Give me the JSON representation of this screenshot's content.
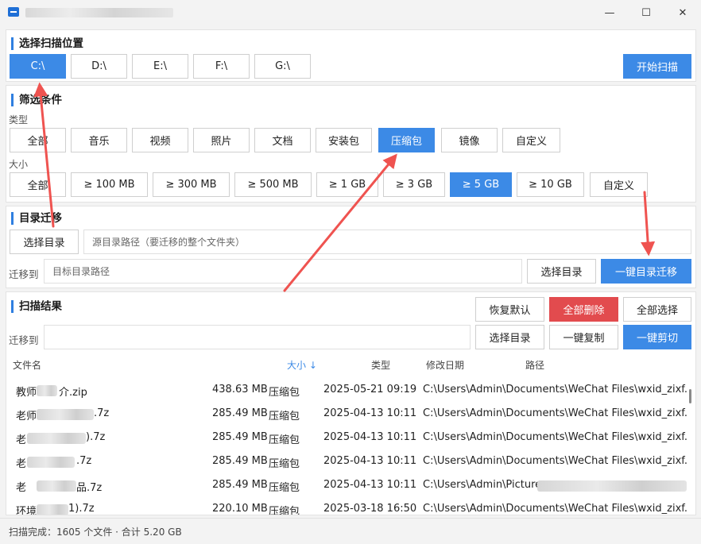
{
  "window": {
    "minimize": "—",
    "maximize": "☐",
    "close": "✕"
  },
  "scan_location": {
    "title": "选择扫描位置",
    "drives": [
      "C:\\",
      "D:\\",
      "E:\\",
      "F:\\",
      "G:\\"
    ],
    "selected_drive": "C:\\",
    "start_button": "开始扫描"
  },
  "filter": {
    "title": "筛选条件",
    "type_label": "类型",
    "types": [
      "全部",
      "音乐",
      "视频",
      "照片",
      "文档",
      "安装包",
      "压缩包",
      "镜像",
      "自定义"
    ],
    "selected_type": "压缩包",
    "size_label": "大小",
    "sizes": [
      "全部",
      "≥ 100 MB",
      "≥ 300 MB",
      "≥ 500 MB",
      "≥ 1 GB",
      "≥ 3 GB",
      "≥ 5 GB",
      "≥ 10 GB",
      "自定义"
    ],
    "selected_size": "≥ 5 GB"
  },
  "migration": {
    "title": "目录迁移",
    "choose_dir_button": "选择目录",
    "source_placeholder": "源目录路径（要迁移的整个文件夹）",
    "target_label": "迁移到",
    "target_placeholder": "目标目录路径",
    "choose_target_button": "选择目录",
    "one_click_migrate": "一键目录迁移"
  },
  "results": {
    "title": "扫描结果",
    "restore_default": "恢复默认",
    "delete_all": "全部删除",
    "select_all": "全部选择",
    "target_label": "迁移到",
    "choose_dir_button": "选择目录",
    "copy_button": "一键复制",
    "cut_button": "一键剪切",
    "columns": {
      "name": "文件名",
      "size": "大小 ↓",
      "type": "类型",
      "modified": "修改日期",
      "path": "路径"
    },
    "rows": [
      {
        "name_start": "教师",
        "name_end": "介.zip",
        "size": "438.63 MB",
        "type": "压缩包",
        "date": "2025-05-21 09:19",
        "path": "C:\\Users\\Admin\\Documents\\WeChat Files\\wxid_zixf..."
      },
      {
        "name_start": "老师",
        "name_end": ".7z",
        "size": "285.49 MB",
        "type": "压缩包",
        "date": "2025-04-13 10:11",
        "path": "C:\\Users\\Admin\\Documents\\WeChat Files\\wxid_zixf..."
      },
      {
        "name_start": "老",
        "name_end": ").7z",
        "size": "285.49 MB",
        "type": "压缩包",
        "date": "2025-04-13 10:11",
        "path": "C:\\Users\\Admin\\Documents\\WeChat Files\\wxid_zixf..."
      },
      {
        "name_start": "老",
        "name_end": ".7z",
        "size": "285.49 MB",
        "type": "压缩包",
        "date": "2025-04-13 10:11",
        "path": "C:\\Users\\Admin\\Documents\\WeChat Files\\wxid_zixf..."
      },
      {
        "name_start": "老",
        "name_end": "品.7z",
        "size": "285.49 MB",
        "type": "压缩包",
        "date": "2025-04-13 10:11",
        "path": "C:\\Users\\Admin\\Picture"
      },
      {
        "name_start": "环境",
        "name_end": "1).7z",
        "size": "220.10 MB",
        "type": "压缩包",
        "date": "2025-03-18 16:50",
        "path": "C:\\Users\\Admin\\Documents\\WeChat Files\\wxid_zixf..."
      }
    ]
  },
  "status": {
    "text": "扫描完成：1605 个文件 · 合计 5.20 GB"
  },
  "colors": {
    "accent": "#3c8ae6",
    "danger": "#e24b4e",
    "annotation_arrow": "#ef5350"
  }
}
